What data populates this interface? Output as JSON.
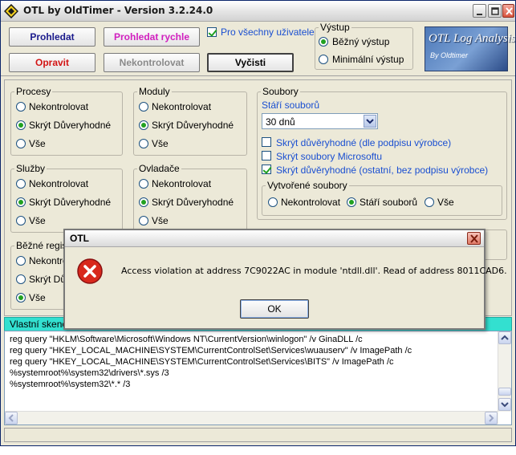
{
  "window": {
    "title": "OTL by OldTimer - Version 3.2.24.0"
  },
  "toolbar": {
    "scan_label": "Prohledat",
    "quick_scan_label": "Prohledat rychle",
    "fix_label": "Opravit",
    "dont_check_label": "Nekontrolovat",
    "clean_label": "Vyčisti",
    "all_users_label": "Pro všechny uživatele",
    "all_users_checked": true
  },
  "output": {
    "title": "Výstup",
    "options": [
      {
        "label": "Běžný výstup",
        "selected": true
      },
      {
        "label": "Minimální výstup",
        "selected": false
      }
    ]
  },
  "logo": {
    "title": "OTL Log Analysis",
    "subtitle": "By Oldtimer"
  },
  "processes": {
    "title": "Procesy",
    "options": [
      {
        "label": "Nekontrolovat",
        "selected": false
      },
      {
        "label": "Skrýt Důveryhodné",
        "selected": true
      },
      {
        "label": "Vše",
        "selected": false
      }
    ]
  },
  "modules": {
    "title": "Moduly",
    "options": [
      {
        "label": "Nekontrolovat",
        "selected": false
      },
      {
        "label": "Skrýt Důveryhodné",
        "selected": true
      },
      {
        "label": "Vše",
        "selected": false
      }
    ]
  },
  "services": {
    "title": "Služby",
    "options": [
      {
        "label": "Nekontrolovat",
        "selected": false
      },
      {
        "label": "Skrýt Důveryhodné",
        "selected": true
      },
      {
        "label": "Vše",
        "selected": false
      }
    ]
  },
  "drivers": {
    "title": "Ovladače",
    "options": [
      {
        "label": "Nekontrolovat",
        "selected": false
      },
      {
        "label": "Skrýt Důveryhodné",
        "selected": true
      },
      {
        "label": "Vše",
        "selected": false
      }
    ]
  },
  "common_registry": {
    "title": "Běžné regis",
    "options": [
      {
        "label": "Nekontro",
        "selected": false
      },
      {
        "label": "Skrýt Dů",
        "selected": false
      },
      {
        "label": "Vše",
        "selected": true
      }
    ]
  },
  "files": {
    "title": "Soubory",
    "age_label": "Stáří souborů",
    "age_value": "30 dnů",
    "checks": [
      {
        "label": "Skrýt důvěryhodné (dle podpisu výrobce)",
        "checked": false
      },
      {
        "label": "Skrýt soubory Microsoftu",
        "checked": false
      },
      {
        "label": "Skrýt důvěryhodné (ostatní, bez podpisu výrobce)",
        "checked": true
      }
    ],
    "created": {
      "title": "Vytvořené soubory",
      "options": [
        {
          "label": "Nekontrolovat",
          "selected": false
        },
        {
          "label": "Stáří souborů",
          "selected": true
        },
        {
          "label": "Vše",
          "selected": false
        }
      ]
    }
  },
  "custom_scan": {
    "label": "Vlastní skeno",
    "lines": [
      "reg query \"HKLM\\Software\\Microsoft\\Windows NT\\CurrentVersion\\winlogon\" /v GinaDLL /c",
      "reg query \"HKEY_LOCAL_MACHINE\\SYSTEM\\CurrentControlSet\\Services\\wuauserv\" /v ImagePath /c",
      "reg query \"HKEY_LOCAL_MACHINE\\SYSTEM\\CurrentControlSet\\Services\\BITS\" /v ImagePath /c",
      "%systemroot%\\system32\\drivers\\*.sys /3",
      "%systemroot%\\system32\\*.* /3"
    ]
  },
  "dialog": {
    "title": "OTL",
    "message": "Access violation at address 7C9022AC in module 'ntdll.dll'. Read of address 8011CAD6.",
    "ok_label": "OK"
  }
}
